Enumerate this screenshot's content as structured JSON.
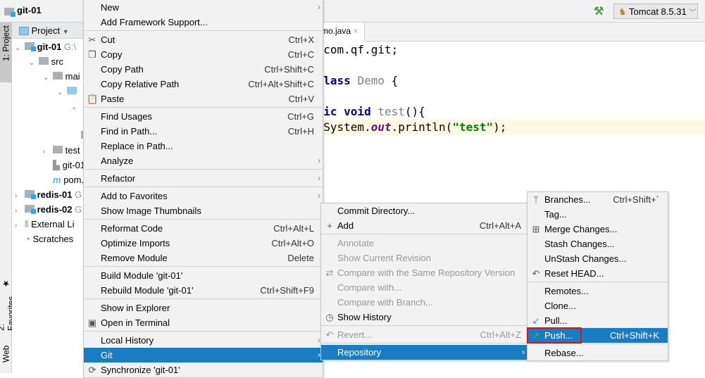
{
  "window": {
    "project_title": "git-01",
    "run_config": "Tomcat 8.5.31",
    "accent": "#1a7dc4"
  },
  "side_tabs": {
    "project": "1: Project",
    "favorites": "2: Favorites",
    "web": "Web"
  },
  "project_panel": {
    "header": "Project",
    "tree": [
      {
        "label": "git-01",
        "suffix": "G:\\",
        "bold": true,
        "indent": 0,
        "chev": "v",
        "icon": "module"
      },
      {
        "label": "src",
        "indent": 1,
        "chev": "v",
        "icon": "folder"
      },
      {
        "label": "mai",
        "indent": 2,
        "chev": "v",
        "icon": "folder"
      },
      {
        "label": "",
        "indent": 3,
        "chev": "v",
        "icon": "folder-blue"
      },
      {
        "label": "",
        "indent": 4,
        "chev": "v",
        "icon": ""
      },
      {
        "label": "",
        "indent": 4,
        "chev": "",
        "icon": ""
      },
      {
        "label": "",
        "indent": 4,
        "chev": "",
        "icon": "resources"
      },
      {
        "label": "test",
        "indent": 2,
        "chev": ">",
        "icon": "folder"
      },
      {
        "label": "git-01.i",
        "indent": 2,
        "chev": "",
        "icon": "iml"
      },
      {
        "label": "pom.xn",
        "indent": 2,
        "chev": "",
        "icon": "maven"
      },
      {
        "label": "redis-01",
        "suffix": "G",
        "bold": true,
        "indent": 0,
        "chev": ">",
        "icon": "module"
      },
      {
        "label": "redis-02",
        "suffix": "G",
        "bold": true,
        "indent": 0,
        "chev": ">",
        "icon": "module"
      },
      {
        "label": "External Li",
        "indent": 0,
        "chev": ">",
        "icon": "library"
      },
      {
        "label": "Scratches",
        "indent": 0,
        "chev": "",
        "icon": "scratch"
      }
    ]
  },
  "editor": {
    "tab": "mo.java",
    "code": [
      [
        [
          "",
          "e "
        ],
        [
          "",
          "com.qf.git;"
        ]
      ],
      [],
      [
        [
          "kw",
          " class "
        ],
        [
          "gr",
          "Demo"
        ],
        [
          "",
          " {"
        ]
      ],
      [],
      [
        [
          "kw",
          "blic void "
        ],
        [
          "gr",
          "test"
        ],
        [
          "",
          "(){"
        ]
      ],
      [
        [
          "",
          "  System."
        ],
        [
          "fld",
          "out"
        ],
        [
          "",
          ".println("
        ],
        [
          "str",
          "\"test\""
        ],
        [
          "",
          ");"
        ]
      ]
    ]
  },
  "context_menu": [
    {
      "label": "New",
      "sub": true
    },
    {
      "label": "Add Framework Support..."
    },
    {
      "sep": true
    },
    {
      "label": "Cut",
      "sc": "Ctrl+X",
      "icon": "✂",
      "iconName": "scissors-icon"
    },
    {
      "label": "Copy",
      "sc": "Ctrl+C",
      "icon": "❐",
      "iconName": "copy-icon"
    },
    {
      "label": "Copy Path",
      "sc": "Ctrl+Shift+C"
    },
    {
      "label": "Copy Relative Path",
      "sc": "Ctrl+Alt+Shift+C"
    },
    {
      "label": "Paste",
      "sc": "Ctrl+V",
      "icon": "📋",
      "iconName": "clipboard-icon"
    },
    {
      "sep": true
    },
    {
      "label": "Find Usages",
      "sc": "Ctrl+G"
    },
    {
      "label": "Find in Path...",
      "sc": "Ctrl+H"
    },
    {
      "label": "Replace in Path..."
    },
    {
      "label": "Analyze",
      "sub": true
    },
    {
      "sep": true
    },
    {
      "label": "Refactor",
      "sub": true
    },
    {
      "sep": true
    },
    {
      "label": "Add to Favorites",
      "sub": true
    },
    {
      "label": "Show Image Thumbnails"
    },
    {
      "sep": true
    },
    {
      "label": "Reformat Code",
      "sc": "Ctrl+Alt+L"
    },
    {
      "label": "Optimize Imports",
      "sc": "Ctrl+Alt+O"
    },
    {
      "label": "Remove Module",
      "sc": "Delete"
    },
    {
      "sep": true
    },
    {
      "label": "Build Module 'git-01'"
    },
    {
      "label": "Rebuild Module 'git-01'",
      "sc": "Ctrl+Shift+F9"
    },
    {
      "sep": true
    },
    {
      "label": "Show in Explorer"
    },
    {
      "label": "Open in Terminal",
      "icon": "▣",
      "iconName": "terminal-icon"
    },
    {
      "sep": true
    },
    {
      "label": "Local History",
      "sub": true
    },
    {
      "label": "Git",
      "sub": true,
      "sel": true
    },
    {
      "label": "Synchronize 'git-01'",
      "icon": "⟳",
      "iconName": "sync-icon"
    }
  ],
  "git_menu": [
    {
      "label": "Commit Directory..."
    },
    {
      "label": "Add",
      "sc": "Ctrl+Alt+A",
      "icon": "+",
      "iconName": "plus-icon"
    },
    {
      "sep": true
    },
    {
      "label": "Annotate",
      "dis": true
    },
    {
      "label": "Show Current Revision",
      "dis": true
    },
    {
      "label": "Compare with the Same Repository Version",
      "dis": true,
      "icon": "⇄",
      "iconName": "compare-icon"
    },
    {
      "label": "Compare with...",
      "dis": true
    },
    {
      "label": "Compare with Branch...",
      "dis": true
    },
    {
      "label": "Show History",
      "icon": "◷",
      "iconName": "clock-icon"
    },
    {
      "sep": true
    },
    {
      "label": "Revert...",
      "sc": "Ctrl+Alt+Z",
      "dis": true,
      "icon": "↶",
      "iconName": "revert-icon"
    },
    {
      "sep": true
    },
    {
      "label": "Repository",
      "sub": true,
      "sel": true
    }
  ],
  "repository_menu": [
    {
      "label": "Branches...",
      "sc": "Ctrl+Shift+`",
      "icon": "ᛘ",
      "iconName": "branch-icon"
    },
    {
      "label": "Tag..."
    },
    {
      "label": "Merge Changes...",
      "icon": "⊞",
      "iconName": "merge-icon"
    },
    {
      "label": "Stash Changes..."
    },
    {
      "label": "UnStash Changes..."
    },
    {
      "label": "Reset HEAD...",
      "icon": "↶",
      "iconName": "reset-icon"
    },
    {
      "sep": true
    },
    {
      "label": "Remotes..."
    },
    {
      "label": "Clone..."
    },
    {
      "label": "Pull...",
      "icon": "↙",
      "iconName": "pull-icon",
      "iconColor": "#3d9be0"
    },
    {
      "label": "Push...",
      "sc": "Ctrl+Shift+K",
      "sel": true,
      "boxed": true,
      "icon": "↗",
      "iconName": "push-icon",
      "iconColor": "#4caf50"
    },
    {
      "sep": true
    },
    {
      "label": "Rebase..."
    }
  ]
}
